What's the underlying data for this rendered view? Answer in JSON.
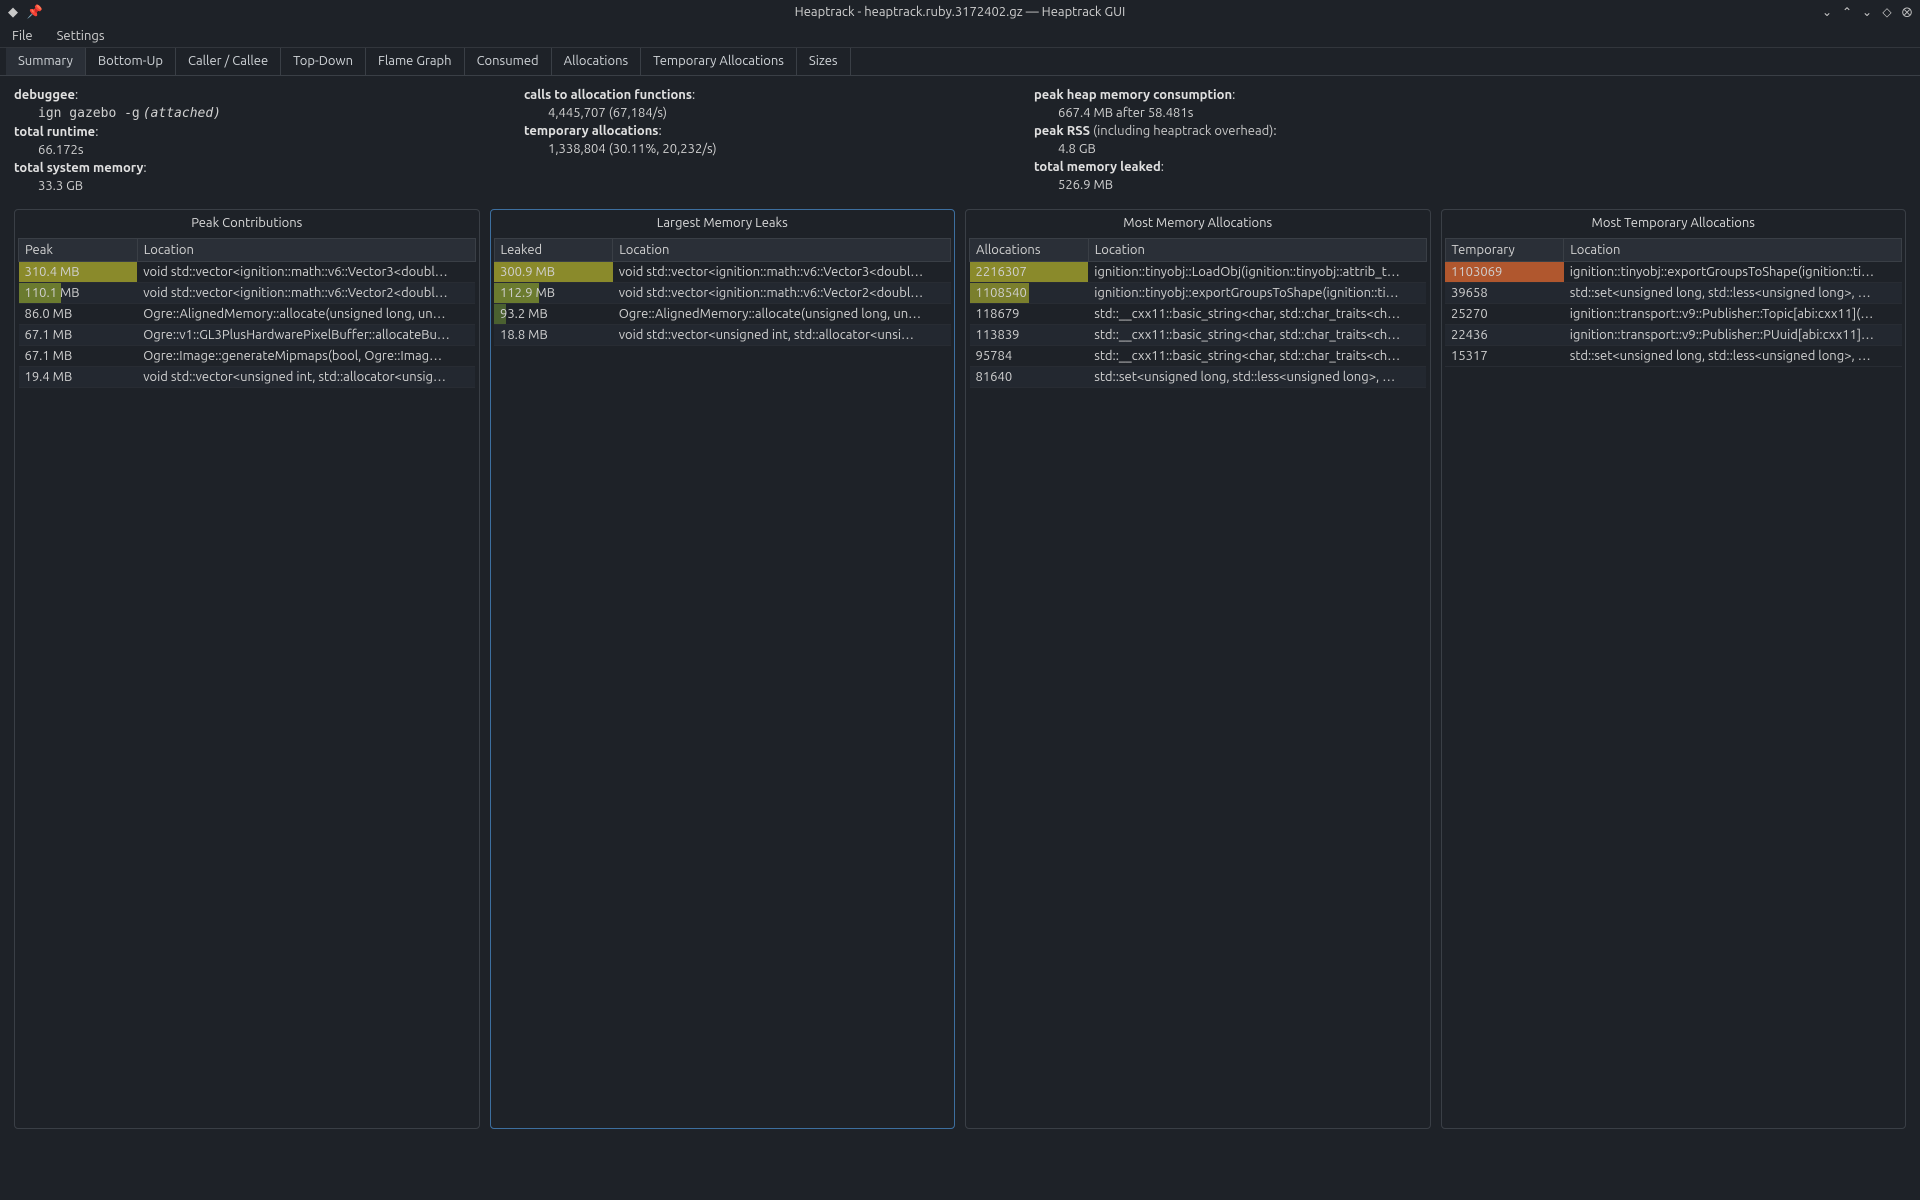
{
  "window": {
    "title": "Heaptrack - heaptrack.ruby.3172402.gz — Heaptrack GUI"
  },
  "menu": {
    "file": "File",
    "settings": "Settings"
  },
  "tabs": [
    "Summary",
    "Bottom-Up",
    "Caller / Callee",
    "Top-Down",
    "Flame Graph",
    "Consumed",
    "Allocations",
    "Temporary Allocations",
    "Sizes"
  ],
  "summary": {
    "col1": {
      "debuggee_label": "debuggee",
      "debuggee_cmd": "ign gazebo -g",
      "debuggee_note": "(attached)",
      "total_runtime_label": "total runtime",
      "total_runtime": "66.172s",
      "total_sys_mem_label": "total system memory",
      "total_sys_mem": "33.3 GB"
    },
    "col2": {
      "calls_label": "calls to allocation functions",
      "calls": "4,445,707 (67,184/s)",
      "temp_label": "temporary allocations",
      "temp": "1,338,804 (30.11%, 20,232/s)"
    },
    "col3": {
      "peak_heap_label": "peak heap memory consumption",
      "peak_heap": "667.4 MB after 58.481s",
      "peak_rss_label": "peak RSS",
      "peak_rss_note": "(including heaptrack overhead)",
      "peak_rss": "4.8 GB",
      "leaked_label": "total memory leaked",
      "leaked": "526.9 MB"
    }
  },
  "panels": {
    "peak": {
      "title": "Peak Contributions",
      "col1": "Peak",
      "col2": "Location",
      "rows": [
        {
          "m": "310.4 MB",
          "loc": "void std::vector<ignition::math::v6::Vector3<doubl…",
          "heat": 100,
          "hc": "#8a8a2b"
        },
        {
          "m": "110.1 MB",
          "loc": "void std::vector<ignition::math::v6::Vector2<doubl…",
          "heat": 36,
          "hc": "#6b7b2f"
        },
        {
          "m": "86.0 MB",
          "loc": "Ogre::AlignedMemory::allocate(unsigned long, un…",
          "heat": 0
        },
        {
          "m": "67.1 MB",
          "loc": "Ogre::v1::GL3PlusHardwarePixelBuffer::allocateBu…",
          "heat": 0
        },
        {
          "m": "67.1 MB",
          "loc": "Ogre::Image::generateMipmaps(bool, Ogre::Imag…",
          "heat": 0
        },
        {
          "m": "19.4 MB",
          "loc": "void std::vector<unsigned int, std::allocator<unsig…",
          "heat": 0
        }
      ]
    },
    "leaks": {
      "title": "Largest Memory Leaks",
      "col1": "Leaked",
      "col2": "Location",
      "rows": [
        {
          "m": "300.9 MB",
          "loc": "void std::vector<ignition::math::v6::Vector3<doubl…",
          "heat": 100,
          "hc": "#8a8a2b"
        },
        {
          "m": "112.9 MB",
          "loc": "void std::vector<ignition::math::v6::Vector2<doubl…",
          "heat": 38,
          "hc": "#6b7b2f"
        },
        {
          "m": "93.2 MB",
          "loc": "Ogre::AlignedMemory::allocate(unsigned long, un…",
          "heat": 10,
          "hc": "#4a6030"
        },
        {
          "m": "18.8 MB",
          "loc": "void std::vector<unsigned int, std::allocator<unsi…",
          "heat": 0
        }
      ]
    },
    "alloc": {
      "title": "Most Memory Allocations",
      "col1": "Allocations",
      "col2": "Location",
      "rows": [
        {
          "m": "2216307",
          "loc": "ignition::tinyobj::LoadObj(ignition::tinyobj::attrib_t…",
          "heat": 100,
          "hc": "#8a8a2b"
        },
        {
          "m": "1108540",
          "loc": "ignition::tinyobj::exportGroupsToShape(ignition::ti…",
          "heat": 50,
          "hc": "#7a7f2d"
        },
        {
          "m": "118679",
          "loc": "std::__cxx11::basic_string<char, std::char_traits<ch…",
          "heat": 0
        },
        {
          "m": "113839",
          "loc": "std::__cxx11::basic_string<char, std::char_traits<ch…",
          "heat": 0
        },
        {
          "m": "95784",
          "loc": "std::__cxx11::basic_string<char, std::char_traits<ch…",
          "heat": 0
        },
        {
          "m": "81640",
          "loc": "std::set<unsigned long, std::less<unsigned long>, …",
          "heat": 0
        }
      ]
    },
    "temp": {
      "title": "Most Temporary Allocations",
      "col1": "Temporary",
      "col2": "Location",
      "rows": [
        {
          "m": "1103069",
          "loc": "ignition::tinyobj::exportGroupsToShape(ignition::ti…",
          "heat": 100,
          "hc": "#b0572e"
        },
        {
          "m": "39658",
          "loc": "std::set<unsigned long, std::less<unsigned long>, …",
          "heat": 0
        },
        {
          "m": "25270",
          "loc": "ignition::transport::v9::Publisher::Topic[abi:cxx11](…",
          "heat": 0
        },
        {
          "m": "22436",
          "loc": "ignition::transport::v9::Publisher::PUuid[abi:cxx11]…",
          "heat": 0
        },
        {
          "m": "15317",
          "loc": "std::set<unsigned long, std::less<unsigned long>, …",
          "heat": 0
        }
      ]
    }
  }
}
